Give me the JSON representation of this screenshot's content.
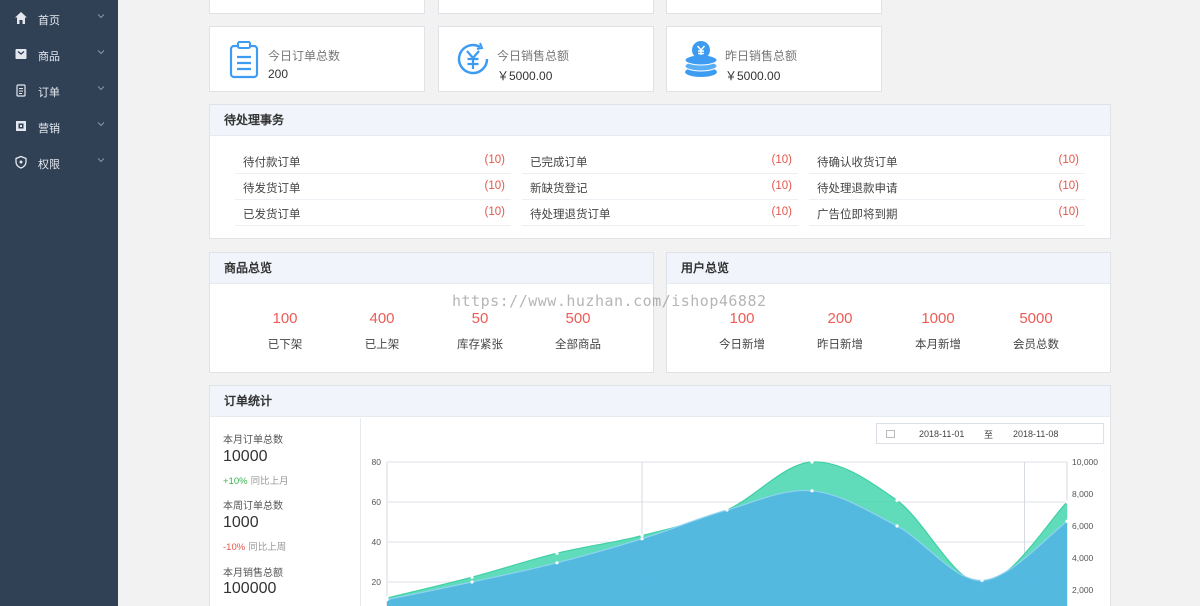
{
  "sidebar": {
    "items": [
      {
        "label": "首页",
        "icon": "home-icon"
      },
      {
        "label": "商品",
        "icon": "product-icon"
      },
      {
        "label": "订单",
        "icon": "order-icon"
      },
      {
        "label": "营销",
        "icon": "marketing-icon"
      },
      {
        "label": "权限",
        "icon": "shield-icon"
      }
    ]
  },
  "stats": [
    {
      "label": "今日订单总数",
      "value": "200",
      "icon": "clipboard-icon"
    },
    {
      "label": "今日销售总额",
      "value": "￥5000.00",
      "icon": "yuan-icon"
    },
    {
      "label": "昨日销售总额",
      "value": "￥5000.00",
      "icon": "coins-icon"
    }
  ],
  "pending": {
    "title": "待处理事务",
    "rows": [
      [
        {
          "label": "待付款订单",
          "count": "(10)"
        },
        {
          "label": "已完成订单",
          "count": "(10)"
        },
        {
          "label": "待确认收货订单",
          "count": "(10)"
        }
      ],
      [
        {
          "label": "待发货订单",
          "count": "(10)"
        },
        {
          "label": "新缺货登记",
          "count": "(10)"
        },
        {
          "label": "待处理退款申请",
          "count": "(10)"
        }
      ],
      [
        {
          "label": "已发货订单",
          "count": "(10)"
        },
        {
          "label": "待处理退货订单",
          "count": "(10)"
        },
        {
          "label": "广告位即将到期",
          "count": "(10)"
        }
      ]
    ]
  },
  "products": {
    "title": "商品总览",
    "items": [
      {
        "value": "100",
        "label": "已下架"
      },
      {
        "value": "400",
        "label": "已上架"
      },
      {
        "value": "50",
        "label": "库存紧张"
      },
      {
        "value": "500",
        "label": "全部商品"
      }
    ]
  },
  "users": {
    "title": "用户总览",
    "items": [
      {
        "value": "100",
        "label": "今日新增"
      },
      {
        "value": "200",
        "label": "昨日新增"
      },
      {
        "value": "1000",
        "label": "本月新增"
      },
      {
        "value": "5000",
        "label": "会员总数"
      }
    ]
  },
  "orders": {
    "title": "订单统计",
    "metrics": [
      {
        "label": "本月订单总数",
        "value": "10000",
        "delta": "+10%",
        "compare": "同比上月",
        "trend": "up"
      },
      {
        "label": "本周订单总数",
        "value": "1000",
        "delta": "-10%",
        "compare": "同比上周",
        "trend": "down"
      },
      {
        "label": "本月销售总额",
        "value": "100000"
      }
    ],
    "date_range": {
      "start": "2018-11-01",
      "separator": "至",
      "end": "2018-11-08"
    }
  },
  "watermark": "https://www.huzhan.com/ishop46882",
  "colors": {
    "sidebar": "#304156",
    "accent_icon": "#3d9cf2",
    "count_red": "#e2574c",
    "area_green": "#4fd8b4",
    "area_blue": "#52b6e0"
  },
  "chart_data": {
    "type": "area",
    "x": [
      0,
      1,
      2,
      3,
      4,
      5,
      6,
      7,
      8
    ],
    "left_axis": {
      "ticks": [
        "80",
        "60",
        "40",
        "20"
      ],
      "ylim": [
        0,
        80
      ]
    },
    "right_axis": {
      "ticks": [
        "10,000",
        "8,000",
        "6,000",
        "4,000",
        "2,000"
      ],
      "ylim": [
        0,
        10000
      ]
    },
    "series": [
      {
        "values": [
          1500,
          2800,
          4300,
          5400,
          7000,
          10000,
          7600,
          2400,
          7500
        ],
        "color": "#4fd8b4"
      },
      {
        "values": [
          1400,
          2500,
          3700,
          5200,
          7000,
          8200,
          6000,
          2600,
          6300
        ],
        "color": "#52b6e0"
      }
    ]
  }
}
